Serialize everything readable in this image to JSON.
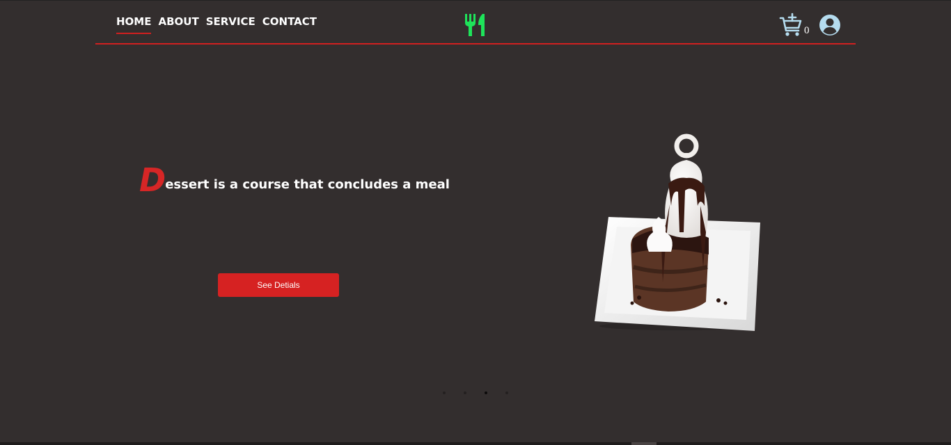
{
  "nav": {
    "items": [
      {
        "label": "HOME",
        "active": true
      },
      {
        "label": "ABOUT",
        "active": false
      },
      {
        "label": "SERVICE",
        "active": false
      },
      {
        "label": "CONTACT",
        "active": false
      }
    ]
  },
  "logo": {
    "icon": "fork-knife-icon",
    "color": "#1ee35a"
  },
  "cart": {
    "icon": "cart-plus-icon",
    "count": "0"
  },
  "user": {
    "icon": "user-circle-icon"
  },
  "hero": {
    "headline_initial": "D",
    "headline_rest": "essert is a course that concludes a meal",
    "button_label": "See Detials",
    "image": "chocolate-lava-cake-sundae"
  },
  "carousel": {
    "slide_count": 4,
    "active_index": 2
  },
  "colors": {
    "background": "#332e2e",
    "accent": "#d62222",
    "logo": "#1ee35a",
    "icon": "#b5dcef"
  }
}
